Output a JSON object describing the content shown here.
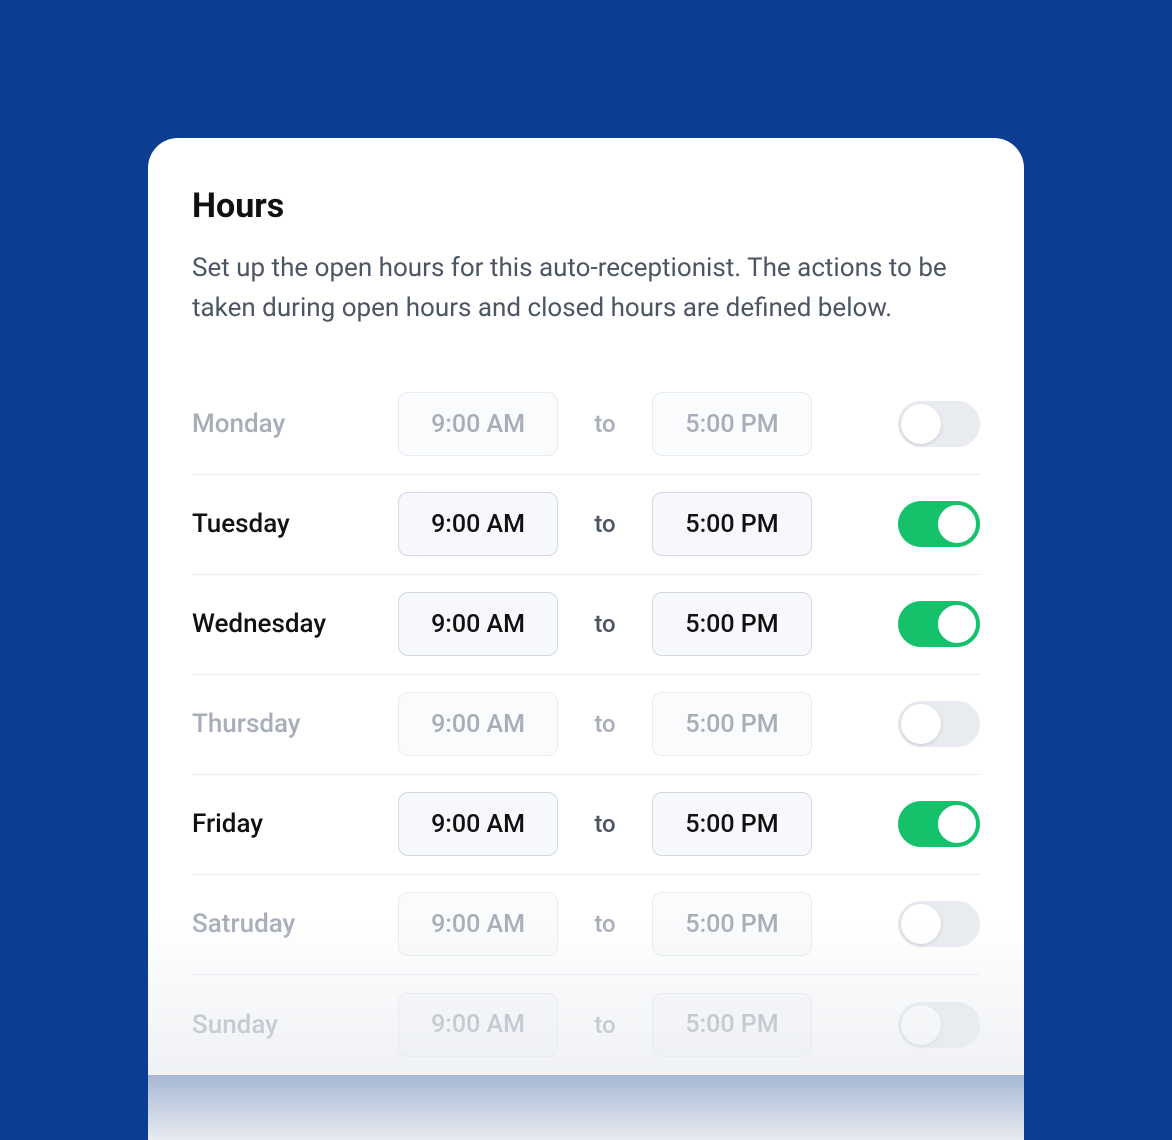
{
  "title": "Hours",
  "description": "Set up the open hours for this auto-receptionist. The actions to be taken during open hours and closed hours are defined below.",
  "to_label": "to",
  "days": [
    {
      "name": "Monday",
      "open": "9:00 AM",
      "close": "5:00 PM",
      "enabled": false
    },
    {
      "name": "Tuesday",
      "open": "9:00 AM",
      "close": "5:00 PM",
      "enabled": true
    },
    {
      "name": "Wednesday",
      "open": "9:00 AM",
      "close": "5:00 PM",
      "enabled": true
    },
    {
      "name": "Thursday",
      "open": "9:00 AM",
      "close": "5:00 PM",
      "enabled": false
    },
    {
      "name": "Friday",
      "open": "9:00 AM",
      "close": "5:00 PM",
      "enabled": true
    },
    {
      "name": "Satruday",
      "open": "9:00 AM",
      "close": "5:00 PM",
      "enabled": false
    },
    {
      "name": "Sunday",
      "open": "9:00 AM",
      "close": "5:00 PM",
      "enabled": false
    }
  ],
  "colors": {
    "brand_bg": "#0b3d91",
    "toggle_on": "#15c26b",
    "toggle_off": "#e8ebf0"
  }
}
